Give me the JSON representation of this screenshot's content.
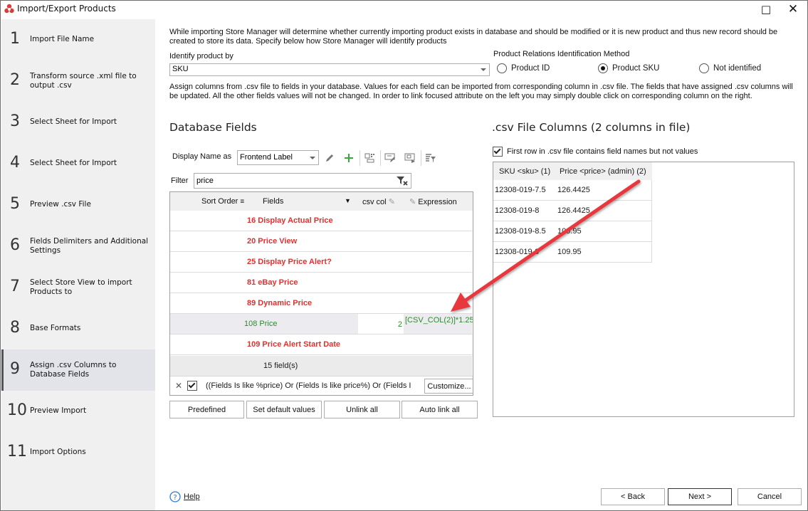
{
  "window": {
    "title": "Import/Export Products",
    "maximize_icon": "□",
    "close_icon": "✕"
  },
  "sidebar": {
    "steps": [
      {
        "num": "1",
        "label": "Import File Name"
      },
      {
        "num": "2",
        "label": "Transform source .xml file to output .csv"
      },
      {
        "num": "3",
        "label": "Select Sheet for Import"
      },
      {
        "num": "4",
        "label": "Select Sheet for Import"
      },
      {
        "num": "5",
        "label": "Preview .csv File"
      },
      {
        "num": "6",
        "label": "Fields Delimiters and Additional Settings"
      },
      {
        "num": "7",
        "label": "Select Store View to import Products to"
      },
      {
        "num": "8",
        "label": "Base Formats"
      },
      {
        "num": "9",
        "label": "Assign .csv Columns to Database Fields",
        "active": true
      },
      {
        "num": "10",
        "label": "Preview Import"
      },
      {
        "num": "11",
        "label": "Import Options"
      }
    ]
  },
  "main": {
    "intro": "While importing Store Manager will determine whether currently importing product exists in database and should be modified or it is new product and thus new record should be created to store its data. Specify below how Store Manager will identify products",
    "identify_label": "Identify product by",
    "identify_value": "SKU",
    "relations_label": "Product Relations Identification Method",
    "relations_options": [
      {
        "label": "Product ID",
        "selected": false
      },
      {
        "label": "Product SKU",
        "selected": true
      },
      {
        "label": "Not identified",
        "selected": false
      }
    ],
    "assign_desc": "Assign columns from .csv file to fields in your database. Values for each field can be imported from corresponding column in .csv file. The fields that have assigned .csv columns will be updated. All the other fields values will not be changed. In order to link focused attribute on the left you may simply double click on corresponding column on the right."
  },
  "database_fields": {
    "title": "Database Fields",
    "display_name_label": "Display Name as",
    "display_name_value": "Frontend Label",
    "filter_label": "Filter",
    "filter_value": "price",
    "columns": {
      "sort_order": "Sort Order",
      "fields": "Fields",
      "csv_col": "csv col",
      "expression": "Expression"
    },
    "rows": [
      {
        "label": "16 Display Actual Price",
        "linked": false,
        "csv_col": "",
        "expression": ""
      },
      {
        "label": "20 Price View",
        "linked": false,
        "csv_col": "",
        "expression": ""
      },
      {
        "label": "25 Display Price Alert?",
        "linked": false,
        "csv_col": "",
        "expression": ""
      },
      {
        "label": "81 eBay Price",
        "linked": false,
        "csv_col": "",
        "expression": ""
      },
      {
        "label": "89 Dynamic Price",
        "linked": false,
        "csv_col": "",
        "expression": ""
      },
      {
        "label": "108 Price",
        "linked": true,
        "csv_col": "2",
        "expression": "[CSV_COL(2)]*1.25"
      },
      {
        "label": "109 Price Alert Start Date",
        "linked": false,
        "csv_col": "",
        "expression": ""
      }
    ],
    "footer_count": "15 field(s)",
    "filter_expression": "((Fields  Is like %price) Or (Fields  Is like price%) Or (Fields  I",
    "customize_label": "Customize...",
    "buttons": {
      "predefined": "Predefined",
      "set_default": "Set default values",
      "unlink_all": "Unlink all",
      "auto_link_all": "Auto link all"
    }
  },
  "csv_columns": {
    "title": ".csv File Columns (2 columns in file)",
    "first_row_label": "First row in .csv file contains field names but not values",
    "first_row_checked": true,
    "headers": [
      "SKU <sku> (1)",
      "Price <price> (admin) (2)"
    ],
    "rows": [
      [
        "12308-019-7.5",
        "126.4425"
      ],
      [
        "12308-019-8",
        "126.4425"
      ],
      [
        "12308-019-8.5",
        "109.95"
      ],
      [
        "12308-019-9",
        "109.95"
      ]
    ]
  },
  "footer": {
    "help_label": "Help",
    "back_label": "< Back",
    "next_label": "Next >",
    "cancel_label": "Cancel"
  },
  "colors": {
    "unlinked_field": "#e03131",
    "linked_field": "#2e8b2e",
    "annotation_arrow": "#e8383d"
  }
}
